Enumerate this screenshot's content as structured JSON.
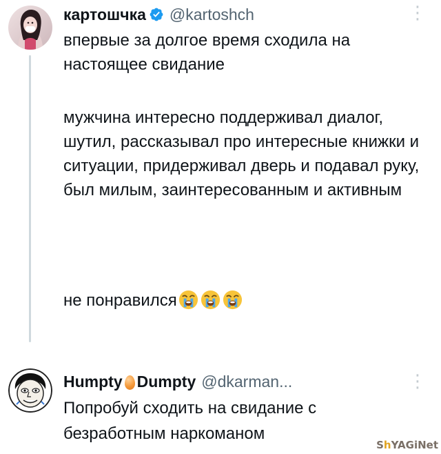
{
  "posts": [
    {
      "author_name": "картошчка",
      "handle": "@kartoshch",
      "verified": true,
      "paragraphs": [
        "впервые за долгое время сходила на настоящее свидание",
        "мужчина интересно поддерживал диалог, шутил, рассказывал про интересные книжки и ситуации, придерживал дверь и подавал руку, был милым, заинтересованным и активным",
        "не понравился"
      ],
      "trailing_emoji": [
        "loudly-crying-face-icon",
        "loudly-crying-face-icon",
        "loudly-crying-face-icon"
      ],
      "more_icon": "more-vertical-icon"
    },
    {
      "author_name_part1": "Humpty",
      "author_name_emoji": "egg-icon",
      "author_name_part2": "Dumpty",
      "handle": "@dkarman...",
      "text": "Попробуй сходить на свидание с безработным наркоманом",
      "more_icon": "more-vertical-icon"
    }
  ],
  "watermark": {
    "part1": "S",
    "part2": "h",
    "part3": "YAGiNet"
  },
  "colors": {
    "text": "#0f1419",
    "secondary": "#536471",
    "verified": "#1d9bf0",
    "thread_line": "#cfd9de",
    "more_icon": "#c5ccd1"
  }
}
